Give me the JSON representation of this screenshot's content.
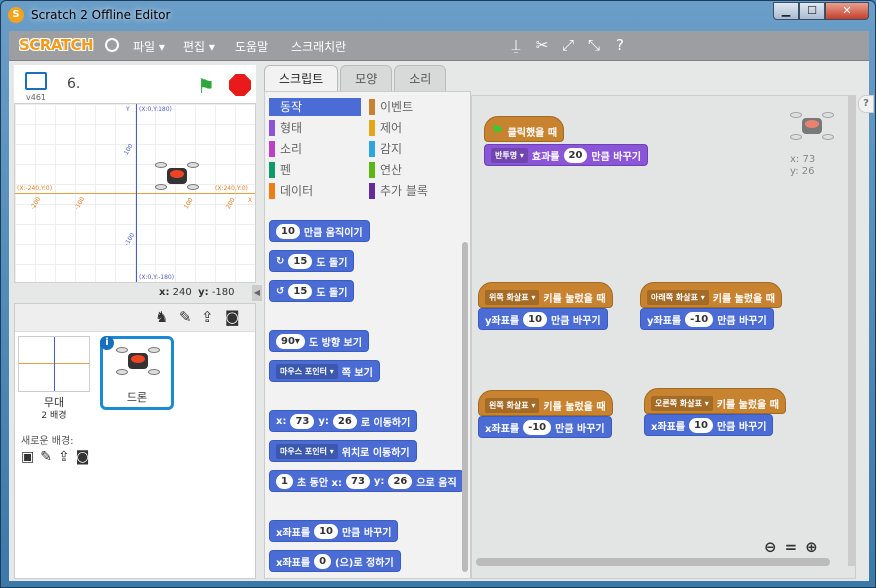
{
  "window": {
    "title": "Scratch 2 Offline Editor",
    "min": "▁",
    "max": "☐",
    "close": "✕"
  },
  "menu": {
    "logo": "SCRATCH",
    "items": [
      "파일 ▾",
      "편집 ▾",
      "도움말",
      "스크래치란"
    ]
  },
  "stage": {
    "version": "v461",
    "project_name": "6.",
    "mouse_x": "240",
    "mouse_y": "-180",
    "x_label": "x:",
    "y_label": "y:",
    "grid_labels": {
      "y_axis": "Y",
      "top": "(X:0,Y:180)",
      "bottom": "(X:0,Y:-180)",
      "left": "(X:-240,Y:0)",
      "right": "(X:240,Y:0)",
      "x_axis": "X",
      "t100": "100",
      "tm100": "-100",
      "l100": "-100",
      "r100": "100",
      "l200": "-200",
      "r200": "200"
    }
  },
  "sprites": {
    "stage_label": "무대",
    "stage_sub": "2 배경",
    "new_backdrop": "새로운 배경:",
    "sprite_name": "드론"
  },
  "tabs": [
    "스크립트",
    "모양",
    "소리"
  ],
  "categories": {
    "motion": "동작",
    "looks": "형태",
    "sound": "소리",
    "pen": "펜",
    "data": "데이터",
    "events": "이벤트",
    "control": "제어",
    "sensing": "감지",
    "operators": "연산",
    "more": "추가 블록"
  },
  "colors": {
    "motion": "#4a6cd4",
    "looks": "#8a55d7",
    "sound": "#bb42c3",
    "pen": "#0e9a6c",
    "data": "#ee7d16",
    "events": "#c88330",
    "control": "#e1a91a",
    "sensing": "#2ca5e2",
    "operators": "#5cb712",
    "more": "#632d99"
  },
  "palette": {
    "b1": {
      "val": "10",
      "text": "만큼 움직이기"
    },
    "b2": {
      "val": "15",
      "text": "도 돌기",
      "icon": "↻"
    },
    "b3": {
      "val": "15",
      "text": "도 돌기",
      "icon": "↺"
    },
    "b4": {
      "val": "90▾",
      "text": "도 방향 보기"
    },
    "b5": {
      "drop": "마우스 포인터 ▾",
      "text": "쪽 보기"
    },
    "b6": {
      "x": "x:",
      "xv": "73",
      "y": "y:",
      "yv": "26",
      "text": "로 이동하기"
    },
    "b7": {
      "drop": "마우스 포인터 ▾",
      "text": "위치로 이동하기"
    },
    "b8": {
      "v": "1",
      "t1": "초 동안 x:",
      "xv": "73",
      "t2": "y:",
      "yv": "26",
      "t3": "으로 움직"
    },
    "b9": {
      "text": "x좌표를",
      "val": "10",
      "text2": "만큼 바꾸기"
    },
    "b10": {
      "text": "x좌표를",
      "val": "0",
      "text2": "(으)로 정하기"
    }
  },
  "scripts": {
    "flag_hat": "클릭했을 때",
    "effect_drop": "반투명 ▾",
    "effect_text": "효과를",
    "effect_val": "20",
    "effect_text2": "만큼 바꾸기",
    "k1": {
      "key": "위쪽 화살표 ▾",
      "hat": "키를 눌렀을 때",
      "cmd": "y좌표를",
      "val": "10",
      "cmd2": "만큼 바꾸기"
    },
    "k2": {
      "key": "아래쪽 화살표 ▾",
      "hat": "키를 눌렀을 때",
      "cmd": "y좌표를",
      "val": "-10",
      "cmd2": "만큼 바꾸기"
    },
    "k3": {
      "key": "왼쪽 화살표 ▾",
      "hat": "키를 눌렀을 때",
      "cmd": "x좌표를",
      "val": "-10",
      "cmd2": "만큼 바꾸기"
    },
    "k4": {
      "key": "오른쪽 화살표 ▾",
      "hat": "키를 눌렀을 때",
      "cmd": "x좌표를",
      "val": "10",
      "cmd2": "만큼 바꾸기"
    },
    "sprite_x": "x: 73",
    "sprite_y": "y: 26"
  }
}
